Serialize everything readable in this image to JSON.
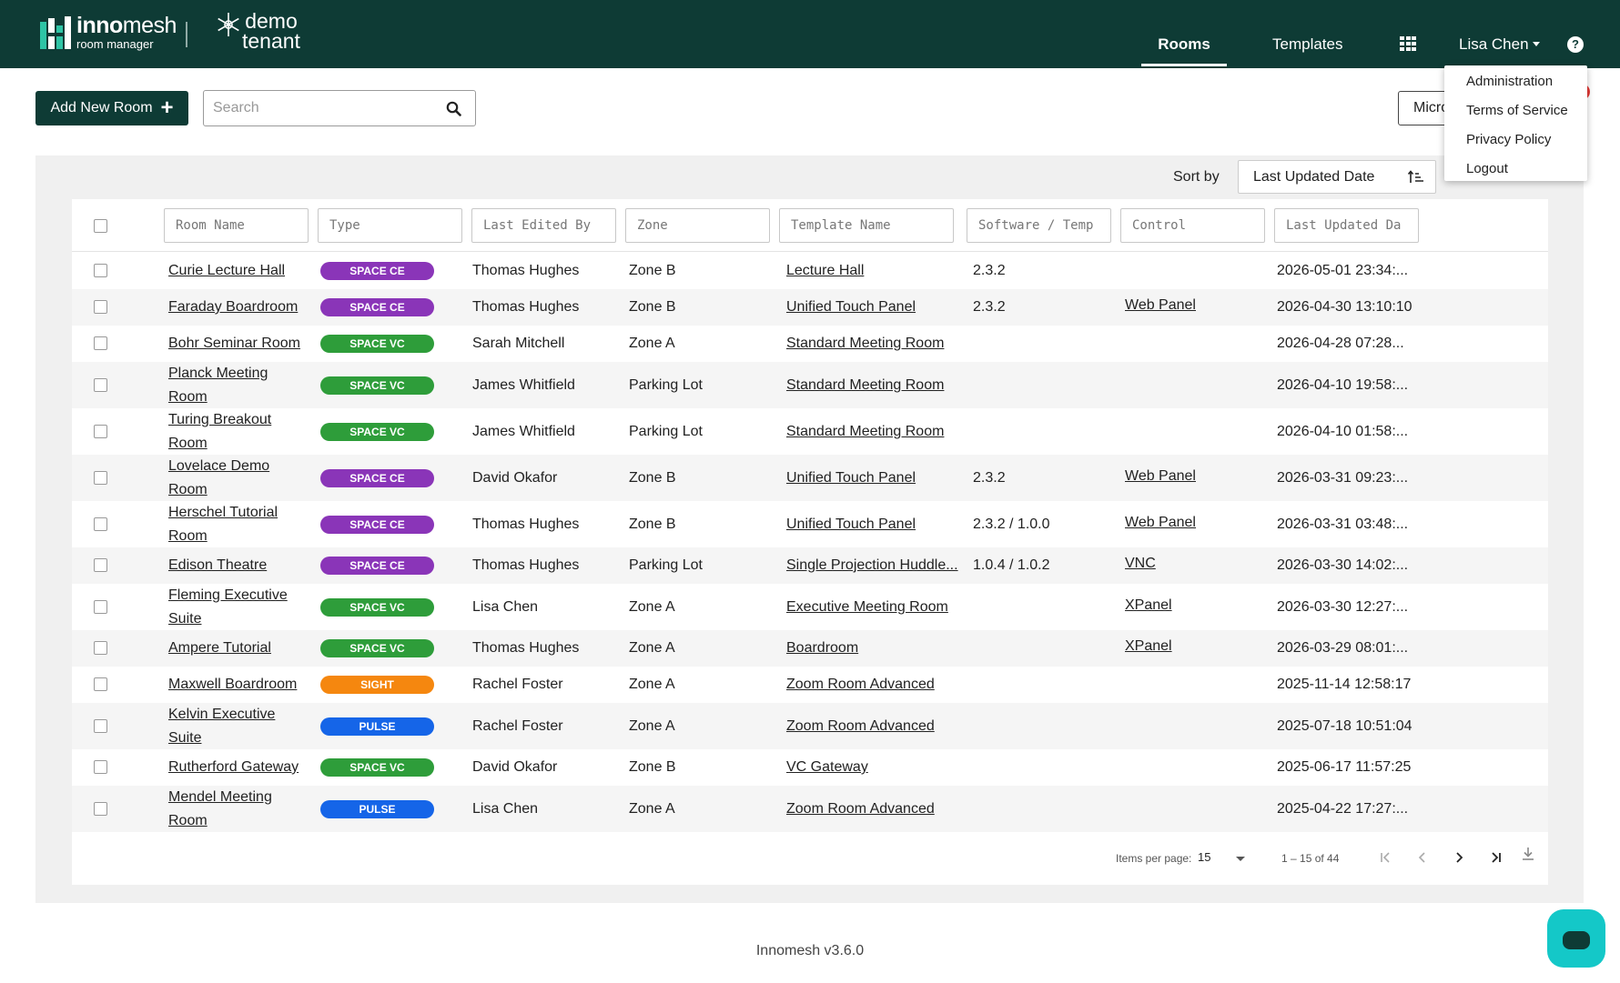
{
  "header": {
    "logo_brand_bold": "inno",
    "logo_brand_rest": "mesh",
    "logo_sub": "room manager",
    "tenant_line1": "demo",
    "tenant_line2": "tenant",
    "nav_rooms": "Rooms",
    "nav_templates": "Templates",
    "user_name": "Lisa Chen",
    "help_glyph": "?"
  },
  "user_dropdown": {
    "items": [
      "Administration",
      "Terms of Service",
      "Privacy Policy",
      "Logout"
    ]
  },
  "toolbar": {
    "add_label": "Add New Room",
    "add_plus": "+",
    "search_placeholder": "Search",
    "mic_button_label": "Micro"
  },
  "sort": {
    "label": "Sort by",
    "value": "Last Updated Date"
  },
  "table": {
    "filters": [
      "Room Name",
      "Type",
      "Last Edited By",
      "Zone",
      "Template Name",
      "Software / Temp",
      "Control",
      "Last Updated Da"
    ],
    "rows": [
      {
        "name_lines": [
          "Curie Lecture Hall"
        ],
        "type": "SPACE CE",
        "type_color": "#8a35b8",
        "editor": "Thomas Hughes",
        "zone": "Zone B",
        "template": "Lecture Hall",
        "software": "2.3.2",
        "control": "",
        "updated": "2026-05-01 23:34:..."
      },
      {
        "name_lines": [
          "Faraday Boardroom"
        ],
        "type": "SPACE CE",
        "type_color": "#8a35b8",
        "editor": "Thomas Hughes",
        "zone": "Zone B",
        "template": "Unified Touch Panel",
        "software": "2.3.2",
        "control": "Web Panel",
        "updated": "2026-04-30 13:10:10"
      },
      {
        "name_lines": [
          "Bohr Seminar Room"
        ],
        "type": "SPACE VC",
        "type_color": "#2e9d3a",
        "editor": "Sarah Mitchell",
        "zone": "Zone A",
        "template": "Standard Meeting Room",
        "software": "",
        "control": "",
        "updated": "2026-04-28 07:28..."
      },
      {
        "name_lines": [
          "Planck Meeting",
          "Room"
        ],
        "type": "SPACE VC",
        "type_color": "#2e9d3a",
        "editor": "James Whitfield",
        "zone": "Parking Lot",
        "template": "Standard Meeting Room",
        "software": "",
        "control": "",
        "updated": "2026-04-10 19:58:..."
      },
      {
        "name_lines": [
          "Turing Breakout",
          "Room"
        ],
        "type": "SPACE VC",
        "type_color": "#2e9d3a",
        "editor": "James Whitfield",
        "zone": "Parking Lot",
        "template": "Standard Meeting Room",
        "software": "",
        "control": "",
        "updated": "2026-04-10 01:58:..."
      },
      {
        "name_lines": [
          "Lovelace Demo",
          "Room"
        ],
        "type": "SPACE CE",
        "type_color": "#8a35b8",
        "editor": "David Okafor",
        "zone": "Zone B",
        "template": "Unified Touch Panel",
        "software": "2.3.2",
        "control": "Web Panel",
        "updated": "2026-03-31 09:23:..."
      },
      {
        "name_lines": [
          "Herschel Tutorial",
          "Room"
        ],
        "type": "SPACE CE",
        "type_color": "#8a35b8",
        "editor": "Thomas Hughes",
        "zone": "Zone B",
        "template": "Unified Touch Panel",
        "software": "2.3.2 / 1.0.0",
        "control": "Web Panel",
        "updated": "2026-03-31 03:48:..."
      },
      {
        "name_lines": [
          "Edison Theatre"
        ],
        "type": "SPACE CE",
        "type_color": "#8a35b8",
        "editor": "Thomas Hughes",
        "zone": "Parking Lot",
        "template": "Single Projection Huddle...",
        "software": "1.0.4 / 1.0.2",
        "control": "VNC",
        "updated": "2026-03-30 14:02:..."
      },
      {
        "name_lines": [
          "Fleming Executive",
          "Suite"
        ],
        "type": "SPACE VC",
        "type_color": "#2e9d3a",
        "editor": "Lisa Chen",
        "zone": "Zone A",
        "template": "Executive Meeting Room",
        "software": "",
        "control": "XPanel",
        "updated": "2026-03-30 12:27:..."
      },
      {
        "name_lines": [
          "Ampere Tutorial"
        ],
        "type": "SPACE VC",
        "type_color": "#2e9d3a",
        "editor": "Thomas Hughes",
        "zone": "Zone A",
        "template": "Boardroom",
        "software": "",
        "control": "XPanel",
        "updated": "2026-03-29 08:01:..."
      },
      {
        "name_lines": [
          "Maxwell Boardroom"
        ],
        "type": "SIGHT",
        "type_color": "#f5870f",
        "editor": "Rachel Foster",
        "zone": "Zone A",
        "template": "Zoom Room Advanced",
        "software": "",
        "control": "",
        "updated": "2025-11-14 12:58:17"
      },
      {
        "name_lines": [
          "Kelvin Executive",
          "Suite"
        ],
        "type": "PULSE",
        "type_color": "#1565e8",
        "editor": "Rachel Foster",
        "zone": "Zone A",
        "template": "Zoom Room Advanced",
        "software": "",
        "control": "",
        "updated": "2025-07-18 10:51:04"
      },
      {
        "name_lines": [
          "Rutherford Gateway"
        ],
        "type": "SPACE VC",
        "type_color": "#2e9d3a",
        "editor": "David Okafor",
        "zone": "Zone B",
        "template": "VC Gateway",
        "software": "",
        "control": "",
        "updated": "2025-06-17 11:57:25"
      },
      {
        "name_lines": [
          "Mendel Meeting",
          "Room"
        ],
        "type": "PULSE",
        "type_color": "#1565e8",
        "editor": "Lisa Chen",
        "zone": "Zone A",
        "template": "Zoom Room Advanced",
        "software": "",
        "control": "",
        "updated": "2025-04-22 17:27:..."
      }
    ]
  },
  "pagination": {
    "items_per_page_label": "Items per page:",
    "items_per_page": "15",
    "range": "1 – 15 of 44"
  },
  "footer": {
    "version": "Innomesh v3.6.0"
  },
  "icons": {
    "search": "search-icon",
    "grid": "apps-grid-icon",
    "help": "help-icon",
    "sort": "sort-ascending-icon",
    "download": "download-icon",
    "chat": "chat-icon"
  },
  "colors": {
    "brand": "#0e3b35",
    "chat": "#14c8c8"
  }
}
